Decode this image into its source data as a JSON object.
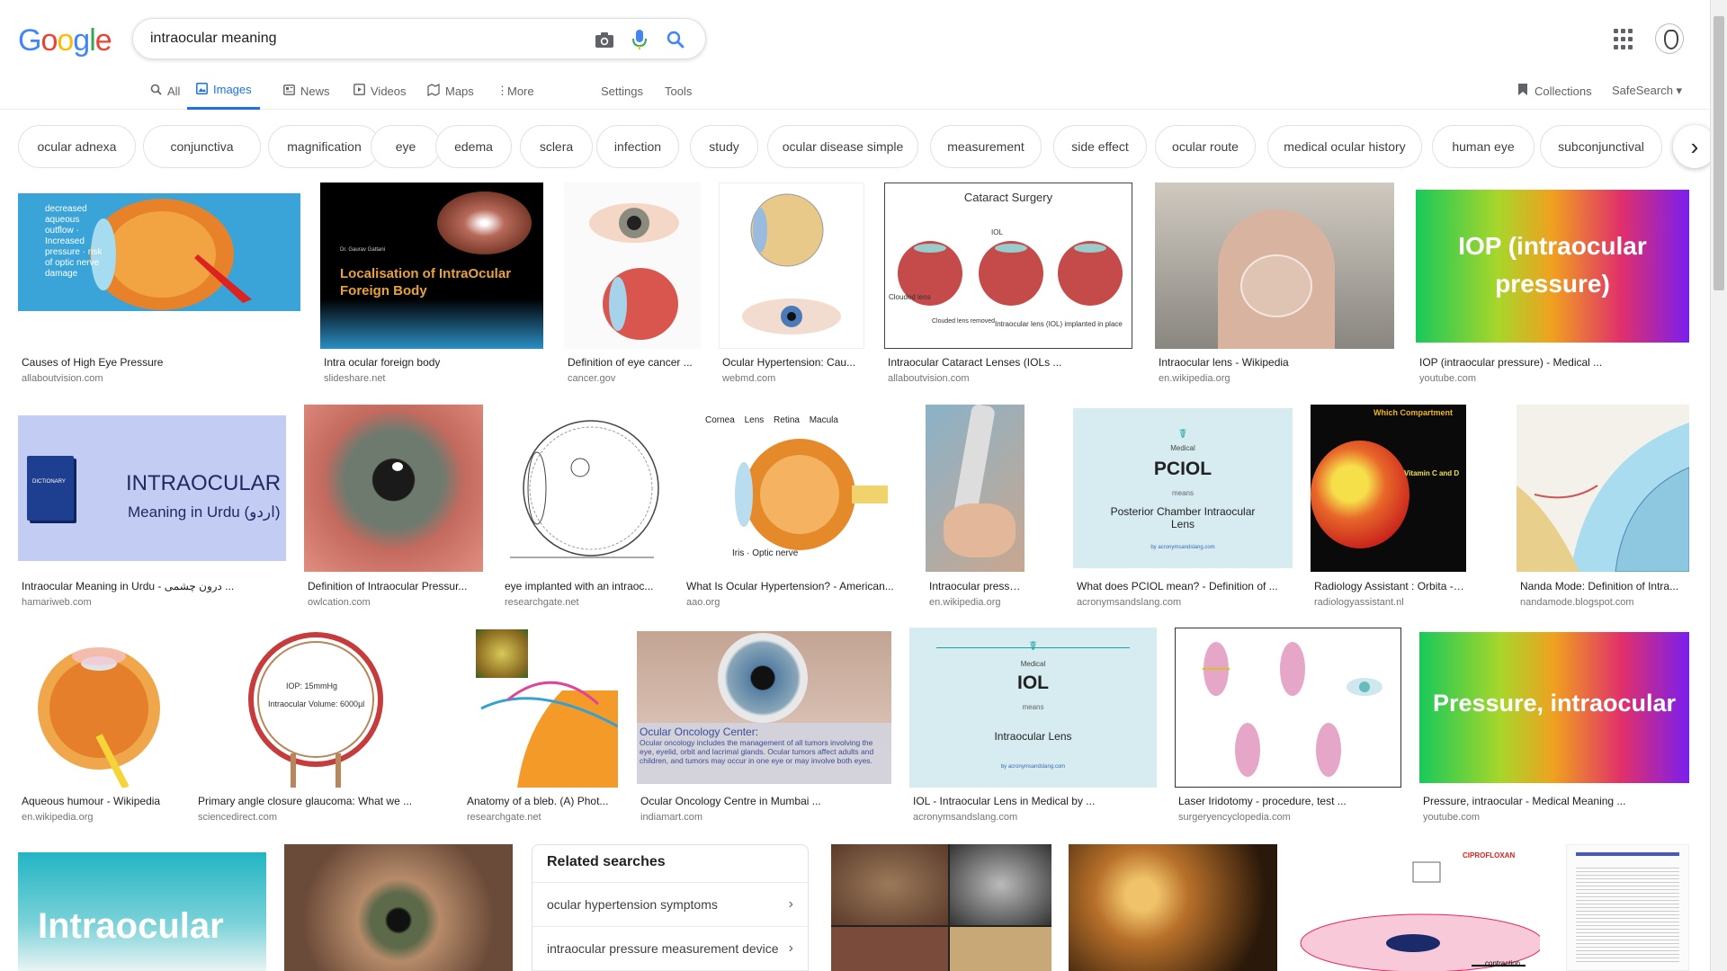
{
  "logo": {
    "letters": [
      "G",
      "o",
      "o",
      "g",
      "l",
      "e"
    ],
    "colors": [
      "#4285f4",
      "#ea4335",
      "#fbbc05",
      "#4285f4",
      "#34a853",
      "#ea4335"
    ]
  },
  "search": {
    "query": "intraocular meaning"
  },
  "header_icons": [
    "camera-icon",
    "mic-icon",
    "search-icon",
    "apps-icon",
    "avatar"
  ],
  "tabs": [
    {
      "label": "All",
      "icon": "search-icon"
    },
    {
      "label": "Images",
      "icon": "image-icon"
    },
    {
      "label": "News",
      "icon": "news-icon"
    },
    {
      "label": "Videos",
      "icon": "video-icon"
    },
    {
      "label": "Maps",
      "icon": "map-icon"
    },
    {
      "label": "More",
      "icon": "more-vert-icon"
    },
    {
      "label": "Settings"
    },
    {
      "label": "Tools"
    },
    {
      "label": "Collections",
      "icon": "collections-icon"
    },
    {
      "label": "SafeSearch ▾"
    }
  ],
  "chips": [
    "ocular adnexa",
    "conjunctiva",
    "magnification",
    "eye",
    "edema",
    "sclera",
    "infection",
    "study",
    "ocular disease simple",
    "measurement",
    "side effect",
    "ocular route",
    "medical ocular history",
    "human eye",
    "subconjunctival"
  ],
  "results": [
    {
      "title": "Causes of High Eye Pressure",
      "source": "allaboutvision.com",
      "thumb_text": "decreased aqueous outflow · Increased pressure · risk of optic nerve damage"
    },
    {
      "title": "Intra ocular foreign body",
      "source": "slideshare.net",
      "thumb_text": "Localisation of IntraOcular Foreign Body",
      "thumb_sub": "Dr. Gaurav Gattani"
    },
    {
      "title": "Definition of eye cancer ...",
      "source": "cancer.gov"
    },
    {
      "title": "Ocular Hypertension: Cau...",
      "source": "webmd.com"
    },
    {
      "title": "Intraocular Cataract Lenses (IOLs ...",
      "source": "allaboutvision.com",
      "thumb_text": "Cataract Surgery",
      "thumb_sub": "Intraocular lens (IOL) implanted in place"
    },
    {
      "title": "Intraocular lens - Wikipedia",
      "source": "en.wikipedia.org"
    },
    {
      "title": "IOP (intraocular pressure) - Medical ...",
      "source": "youtube.com",
      "thumb_text": "IOP (intraocular pressure)"
    },
    {
      "title": "Intraocular Meaning in Urdu - درون چشمی ...",
      "source": "hamariweb.com",
      "thumb_text": "INTRAOCULAR",
      "thumb_sub": "Meaning in Urdu (اردو)"
    },
    {
      "title": "Definition of Intraocular Pressur...",
      "source": "owlcation.com"
    },
    {
      "title": "eye implanted with an intraoc...",
      "source": "researchgate.net"
    },
    {
      "title": "What Is Ocular Hypertension? - American...",
      "source": "aao.org",
      "thumb_text": "Cornea  Lens  Retina  Macula",
      "thumb_sub": "Iris · Optic nerve"
    },
    {
      "title": "Intraocular pressure - ...",
      "source": "en.wikipedia.org"
    },
    {
      "title": "What does PCIOL mean? - Definition of ...",
      "source": "acronymsandslang.com",
      "thumb_text": "PCIOL",
      "thumb_sub": "Posterior Chamber Intraocular Lens"
    },
    {
      "title": "Radiology Assistant : Orbita - path...",
      "source": "radiologyassistant.nl",
      "thumb_text": "Which Compartment",
      "thumb_sub": "Vitamin C and D"
    },
    {
      "title": "Nanda Mode: Definition of Intra...",
      "source": "nandamode.blogspot.com"
    },
    {
      "title": "Aqueous humour - Wikipedia",
      "source": "en.wikipedia.org"
    },
    {
      "title": "Primary angle closure glaucoma: What we ...",
      "source": "sciencedirect.com",
      "thumb_text": "IOP: 15mmHg",
      "thumb_sub": "Intraocular Volume: 6000µl"
    },
    {
      "title": "Anatomy of a bleb. (A) Phot...",
      "source": "researchgate.net"
    },
    {
      "title": "Ocular Oncology Centre in Mumbai ...",
      "source": "indiamart.com",
      "thumb_text": "Ocular Oncology Center:",
      "thumb_sub": "Ocular oncology includes the management of all tumors involving the eye, eyelid, orbit and lacrimal glands. Ocular tumors affect adults and children, and tumors may occur in one eye or may involve both eyes."
    },
    {
      "title": "IOL - Intraocular Lens in Medical by ...",
      "source": "acronymsandslang.com",
      "thumb_text": "IOL",
      "thumb_sub": "Intraocular Lens"
    },
    {
      "title": "Laser Iridotomy - procedure, test ...",
      "source": "surgeryencyclopedia.com"
    },
    {
      "title": "Pressure, intraocular - Medical Meaning ...",
      "source": "youtube.com",
      "thumb_text": "Pressure, intraocular"
    },
    {
      "title": "",
      "source": "",
      "thumb_text": "Intraocular"
    },
    {
      "title": "",
      "source": ""
    },
    {
      "title": "",
      "source": ""
    },
    {
      "title": "",
      "source": ""
    },
    {
      "title": "",
      "source": ""
    },
    {
      "title": "",
      "source": ""
    }
  ],
  "related": {
    "title": "Related searches",
    "items": [
      "ocular hypertension symptoms",
      "intraocular pressure measurement device"
    ]
  },
  "thumb_small_labels": {
    "medical": "Medical",
    "means": "means",
    "by_site": "by acronymsandslang.com",
    "iol": "IOL",
    "clouded_lens": "Clouded lens",
    "clouded_removed": "Clouded lens removed",
    "dictionary": "DICTIONARY",
    "contraction": "contraction",
    "ciprofloxan": "CIPROFLOXAN"
  }
}
